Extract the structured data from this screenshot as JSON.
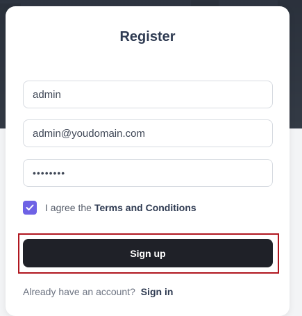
{
  "form": {
    "title": "Register",
    "username": {
      "value": "admin"
    },
    "email": {
      "value": "admin@youdomain.com"
    },
    "password": {
      "value": "••••••••"
    },
    "terms": {
      "checked": true,
      "prefix": "I agree the",
      "link": "Terms and Conditions"
    },
    "submit_label": "Sign up",
    "footer": {
      "text": "Already have an account?",
      "link": "Sign in"
    }
  },
  "colors": {
    "accent": "#6e62e5",
    "button": "#1f2128",
    "highlight_border": "#b0161f"
  },
  "icons": {
    "checkbox": "check-icon"
  }
}
